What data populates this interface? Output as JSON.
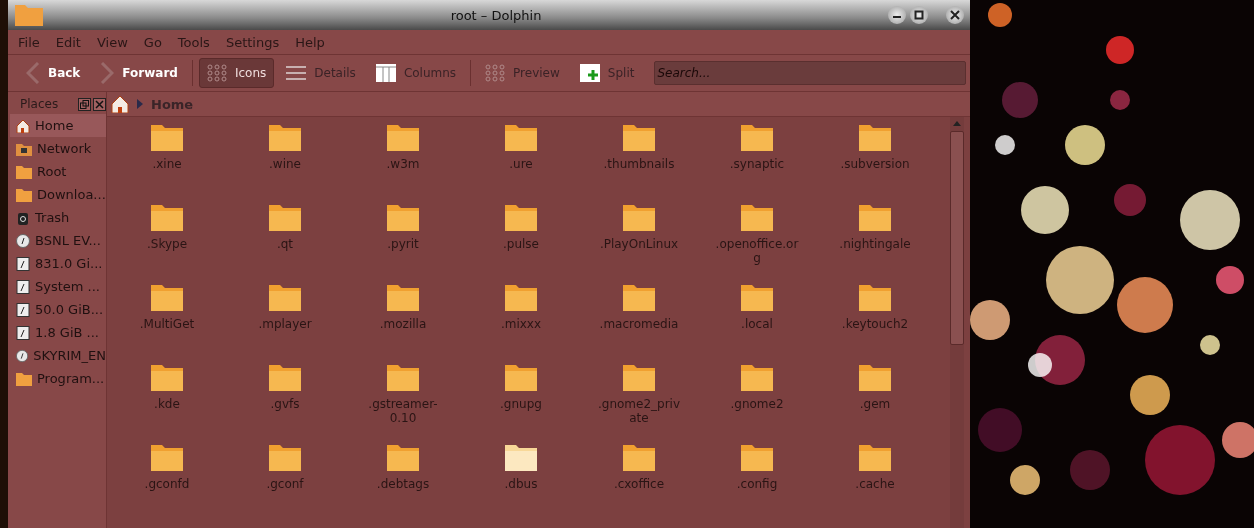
{
  "window": {
    "title": "root – Dolphin"
  },
  "menu": [
    "File",
    "Edit",
    "View",
    "Go",
    "Tools",
    "Settings",
    "Help"
  ],
  "toolbar": [
    {
      "kind": "back",
      "label": "Back",
      "selected": false
    },
    {
      "kind": "forward",
      "label": "Forward",
      "selected": false
    },
    {
      "kind": "icons",
      "label": "Icons",
      "selected": true
    },
    {
      "kind": "details",
      "label": "Details",
      "selected": false
    },
    {
      "kind": "columns",
      "label": "Columns",
      "selected": false
    },
    {
      "kind": "preview",
      "label": "Preview",
      "selected": false
    },
    {
      "kind": "split",
      "label": "Split",
      "selected": false
    }
  ],
  "search": {
    "placeholder": "Search..."
  },
  "places": {
    "title": "Places",
    "items": [
      {
        "kind": "home",
        "label": "Home",
        "selected": true
      },
      {
        "kind": "network",
        "label": "Network",
        "selected": false
      },
      {
        "kind": "folder",
        "label": "Root",
        "selected": false
      },
      {
        "kind": "folder",
        "label": "Downloa...",
        "selected": false
      },
      {
        "kind": "trash",
        "label": "Trash",
        "selected": false
      },
      {
        "kind": "disc",
        "label": "BSNL EV...",
        "selected": false
      },
      {
        "kind": "drive",
        "label": "831.0 Gi...",
        "selected": false
      },
      {
        "kind": "drive",
        "label": "System ...",
        "selected": false
      },
      {
        "kind": "drive",
        "label": "50.0 GiB...",
        "selected": false
      },
      {
        "kind": "drive",
        "label": "1.8 GiB ...",
        "selected": false
      },
      {
        "kind": "disc",
        "label": "SKYRIM_EN",
        "selected": false
      },
      {
        "kind": "folder",
        "label": "Program...",
        "selected": false
      }
    ]
  },
  "breadcrumb": "Home",
  "files": [
    {
      "name": ".xine",
      "selected": false
    },
    {
      "name": ".wine",
      "selected": false
    },
    {
      "name": ".w3m",
      "selected": false
    },
    {
      "name": ".ure",
      "selected": false
    },
    {
      "name": ".thumbnails",
      "selected": false
    },
    {
      "name": ".synaptic",
      "selected": false
    },
    {
      "name": ".subversion",
      "selected": false
    },
    {
      "name": ".Skype",
      "selected": false
    },
    {
      "name": ".qt",
      "selected": false
    },
    {
      "name": ".pyrit",
      "selected": false
    },
    {
      "name": ".pulse",
      "selected": false
    },
    {
      "name": ".PlayOnLinux",
      "selected": false
    },
    {
      "name": ".openoffice.org",
      "selected": false
    },
    {
      "name": ".nightingale",
      "selected": false
    },
    {
      "name": ".MultiGet",
      "selected": false
    },
    {
      "name": ".mplayer",
      "selected": false
    },
    {
      "name": ".mozilla",
      "selected": false
    },
    {
      "name": ".mixxx",
      "selected": false
    },
    {
      "name": ".macromedia",
      "selected": false
    },
    {
      "name": ".local",
      "selected": false
    },
    {
      "name": ".keytouch2",
      "selected": false
    },
    {
      "name": ".kde",
      "selected": false
    },
    {
      "name": ".gvfs",
      "selected": false
    },
    {
      "name": ".gstreamer-0.10",
      "selected": false
    },
    {
      "name": ".gnupg",
      "selected": false
    },
    {
      "name": ".gnome2_private",
      "selected": false
    },
    {
      "name": ".gnome2",
      "selected": false
    },
    {
      "name": ".gem",
      "selected": false
    },
    {
      "name": ".gconfd",
      "selected": false
    },
    {
      "name": ".gconf",
      "selected": false
    },
    {
      "name": ".debtags",
      "selected": false
    },
    {
      "name": ".dbus",
      "selected": true
    },
    {
      "name": ".cxoffice",
      "selected": false
    },
    {
      "name": ".config",
      "selected": false
    },
    {
      "name": ".cache",
      "selected": false
    }
  ]
}
